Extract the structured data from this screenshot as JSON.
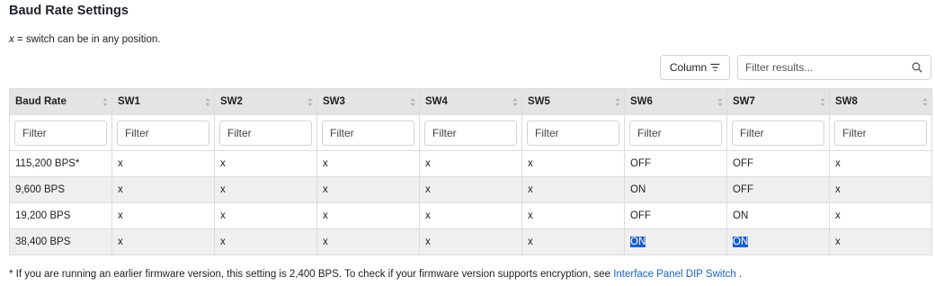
{
  "title": "Baud Rate Settings",
  "note": {
    "symbol": "x",
    "text": " = switch can be in any position."
  },
  "toolbar": {
    "column_label": "Column",
    "search_placeholder": "Filter results..."
  },
  "table": {
    "headers": [
      "Baud Rate",
      "SW1",
      "SW2",
      "SW3",
      "SW4",
      "SW5",
      "SW6",
      "SW7",
      "SW8"
    ],
    "filter_placeholder": "Filter",
    "rows": [
      [
        "115,200 BPS*",
        "x",
        "x",
        "x",
        "x",
        "x",
        "OFF",
        "OFF",
        "x"
      ],
      [
        "9,600 BPS",
        "x",
        "x",
        "x",
        "x",
        "x",
        "ON",
        "OFF",
        "x"
      ],
      [
        "19,200 BPS",
        "x",
        "x",
        "x",
        "x",
        "x",
        "OFF",
        "ON",
        "x"
      ],
      [
        "38,400 BPS",
        "x",
        "x",
        "x",
        "x",
        "x",
        "ON",
        "ON",
        "x"
      ]
    ],
    "selection_color": "#1c5fcf"
  },
  "footnote": {
    "text": "* If you are running an earlier firmware version, this setting is 2,400 BPS. To check if your firmware version supports encryption, see ",
    "link": "Interface Panel DIP Switch",
    "after": " ."
  }
}
